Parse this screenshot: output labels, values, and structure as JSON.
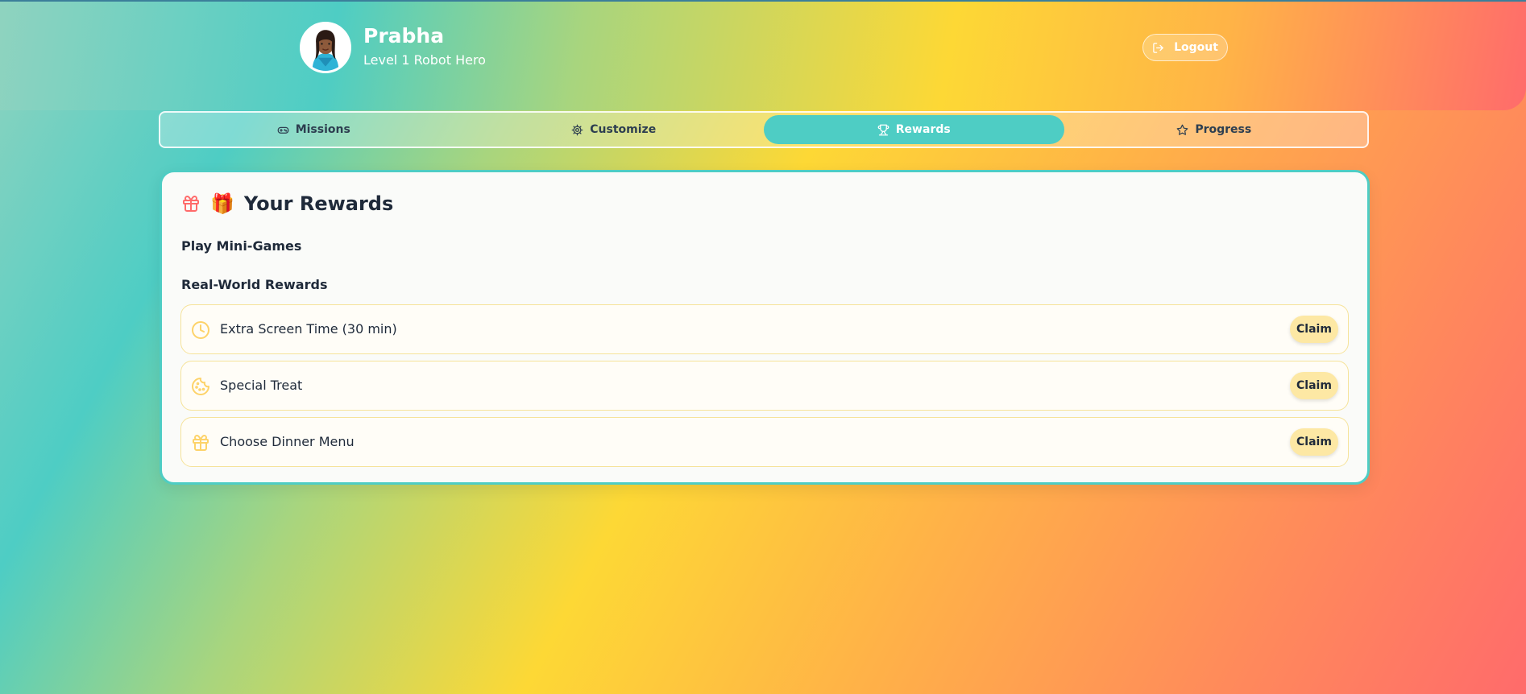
{
  "user": {
    "name": "Prabha",
    "level": "Level 1 Robot Hero"
  },
  "header": {
    "logout_label": "Logout"
  },
  "tabs": [
    {
      "label": "Missions",
      "icon": "gamepad-icon",
      "active": false
    },
    {
      "label": "Customize",
      "icon": "gear-icon",
      "active": false
    },
    {
      "label": "Rewards",
      "icon": "trophy-icon",
      "active": true
    },
    {
      "label": "Progress",
      "icon": "star-icon",
      "active": false
    }
  ],
  "rewards_card": {
    "title": "Your Rewards",
    "title_emoji": "🎁",
    "mini_games_label": "Play Mini-Games",
    "real_world_label": "Real-World Rewards",
    "items": [
      {
        "label": "Extra Screen Time (30 min)",
        "icon": "clock-icon",
        "button": "Claim"
      },
      {
        "label": "Special Treat",
        "icon": "cookie-icon",
        "button": "Claim"
      },
      {
        "label": "Choose Dinner Menu",
        "icon": "gift-icon",
        "button": "Claim"
      }
    ]
  },
  "colors": {
    "accent": "#4ecdc4",
    "gift_red": "#ff6b6b",
    "reward_icon": "#fdd36a",
    "claim_bg": "#fde8a4"
  }
}
